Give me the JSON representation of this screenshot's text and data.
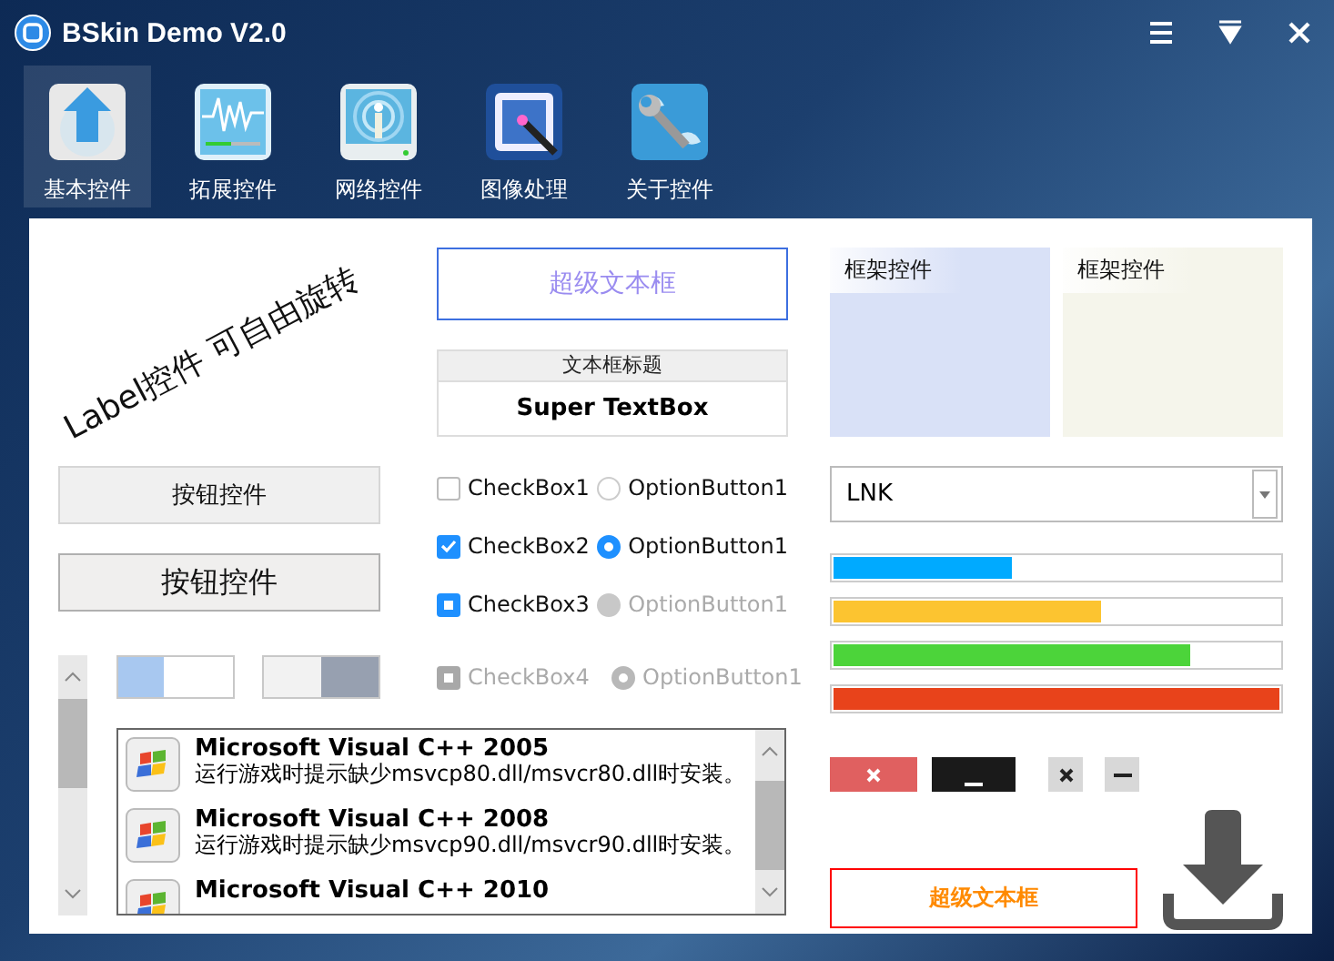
{
  "window": {
    "title": "BSkin Demo V2.0"
  },
  "nav_tabs": [
    {
      "label": "基本控件",
      "kind": "upload",
      "selected": true
    },
    {
      "label": "拓展控件",
      "kind": "pulse",
      "selected": false
    },
    {
      "label": "网络控件",
      "kind": "signal",
      "selected": false
    },
    {
      "label": "图像处理",
      "kind": "wand",
      "selected": false
    },
    {
      "label": "关于控件",
      "kind": "wrench",
      "selected": false
    }
  ],
  "rotated_label": "Label控件 可自由旋转",
  "super_textbox": {
    "placeholder": "超级文本框"
  },
  "titled_textbox": {
    "title": "文本框标题",
    "value": "Super TextBox"
  },
  "buttons": [
    {
      "label": "按钮控件",
      "kind": "flat"
    },
    {
      "label": "按钮控件",
      "kind": "raised"
    }
  ],
  "checkboxes": [
    {
      "label": "CheckBox1",
      "checked": false,
      "partial": false,
      "disabled": false
    },
    {
      "label": "CheckBox2",
      "checked": true,
      "partial": false,
      "disabled": false
    },
    {
      "label": "CheckBox3",
      "checked": true,
      "partial": true,
      "disabled": false
    },
    {
      "label": "CheckBox4",
      "checked": true,
      "partial": true,
      "disabled": true
    }
  ],
  "option_buttons": [
    {
      "label": "OptionButton1",
      "selected": false,
      "disabled": false
    },
    {
      "label": "OptionButton1",
      "selected": true,
      "disabled": false
    },
    {
      "label": "OptionButton1",
      "selected": false,
      "disabled": true
    },
    {
      "label": "OptionButton1",
      "selected": true,
      "disabled": true
    }
  ],
  "list_items": [
    {
      "title": "Microsoft Visual C++ 2005",
      "description": "运行游戏时提示缺少msvcp80.dll/msvcr80.dll时安装。"
    },
    {
      "title": "Microsoft Visual C++ 2008",
      "description": "运行游戏时提示缺少msvcp90.dll/msvcr90.dll时安装。"
    },
    {
      "title": "Microsoft Visual C++ 2010"
    }
  ],
  "frames": [
    {
      "title": "框架控件",
      "color": "#d9e1f7"
    },
    {
      "title": "框架控件",
      "color": "#f5f5eb"
    }
  ],
  "dropdown": {
    "value": "LNK"
  },
  "progress_bars": [
    {
      "level": 0.4,
      "color": "#00aaff"
    },
    {
      "level": 0.6,
      "color": "#fcc430"
    },
    {
      "level": 0.8,
      "color": "#4cd43a"
    },
    {
      "level": 1,
      "color": "#e8431b"
    }
  ],
  "caption_buttons": [
    {
      "kind": "close",
      "solid": true
    },
    {
      "kind": "minimize",
      "solid": true
    },
    {
      "kind": "close",
      "solid": false
    },
    {
      "kind": "minimize",
      "solid": false
    }
  ],
  "bottom_textbox": {
    "value": "超级文本框"
  }
}
